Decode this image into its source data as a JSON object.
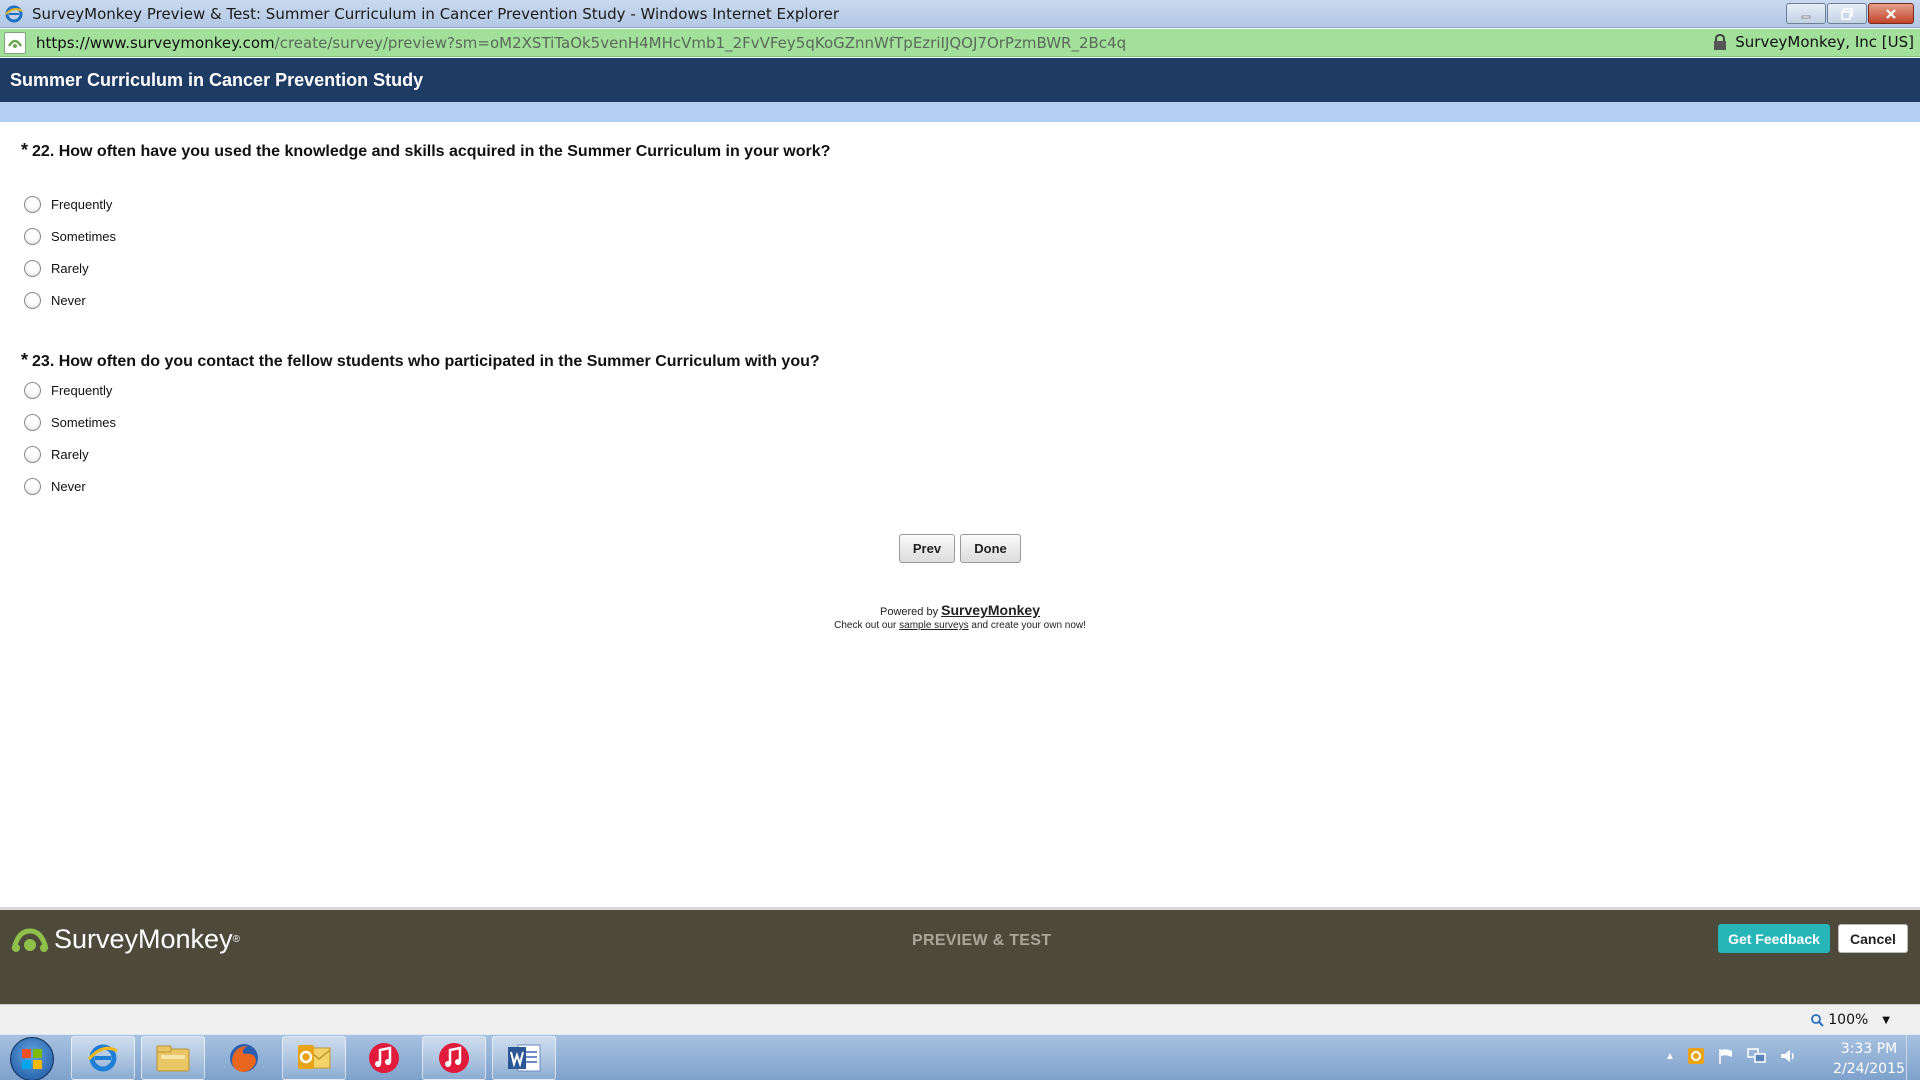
{
  "window": {
    "title": "SurveyMonkey Preview & Test: Summer Curriculum in Cancer Prevention Study - Windows Internet Explorer"
  },
  "address": {
    "url_host": "https://www.surveymonkey.com",
    "url_path": "/create/survey/preview?sm=oM2XSTiTaOk5venH4MHcVmb1_2FvVFey5qKoGZnnWfTpEzriIJQOJ7OrPzmBWR_2Bc4q",
    "site_identity": "SurveyMonkey, Inc [US]"
  },
  "survey": {
    "title": "Summer Curriculum in Cancer Prevention Study",
    "questions": [
      {
        "required_mark": "*",
        "text": "22. How often have you used the knowledge and skills acquired in the Summer Curriculum in your work?",
        "options": [
          "Frequently",
          "Sometimes",
          "Rarely",
          "Never"
        ]
      },
      {
        "required_mark": "*",
        "text": "23. How often do you contact the fellow students who participated in the Summer Curriculum with you?",
        "options": [
          "Frequently",
          "Sometimes",
          "Rarely",
          "Never"
        ]
      }
    ],
    "nav": {
      "prev_label": "Prev",
      "done_label": "Done"
    },
    "footer": {
      "powered_by": "Powered by",
      "brand": "SurveyMonkey",
      "checkout_prefix": "Check out our",
      "checkout_link": "sample surveys",
      "checkout_suffix": "and create your own now!"
    }
  },
  "preview_bar": {
    "logo_text": "SurveyMonkey",
    "logo_reg": "®",
    "label": "PREVIEW & TEST",
    "get_feedback_label": "Get Feedback",
    "cancel_label": "Cancel"
  },
  "statusbar": {
    "zoom": "100%"
  },
  "taskbar": {
    "apps": [
      "internet-explorer",
      "windows-explorer",
      "firefox",
      "outlook",
      "itunes",
      "itunes",
      "word"
    ],
    "clock_time": "3:33 PM",
    "clock_date": "2/24/2015"
  },
  "colors": {
    "survey_header": "#1e3c63",
    "progress_strip": "#b5cff3",
    "address_bar": "#a3e09c",
    "preview_bar": "#4d4a3c",
    "feedback_button": "#27b5b8"
  }
}
